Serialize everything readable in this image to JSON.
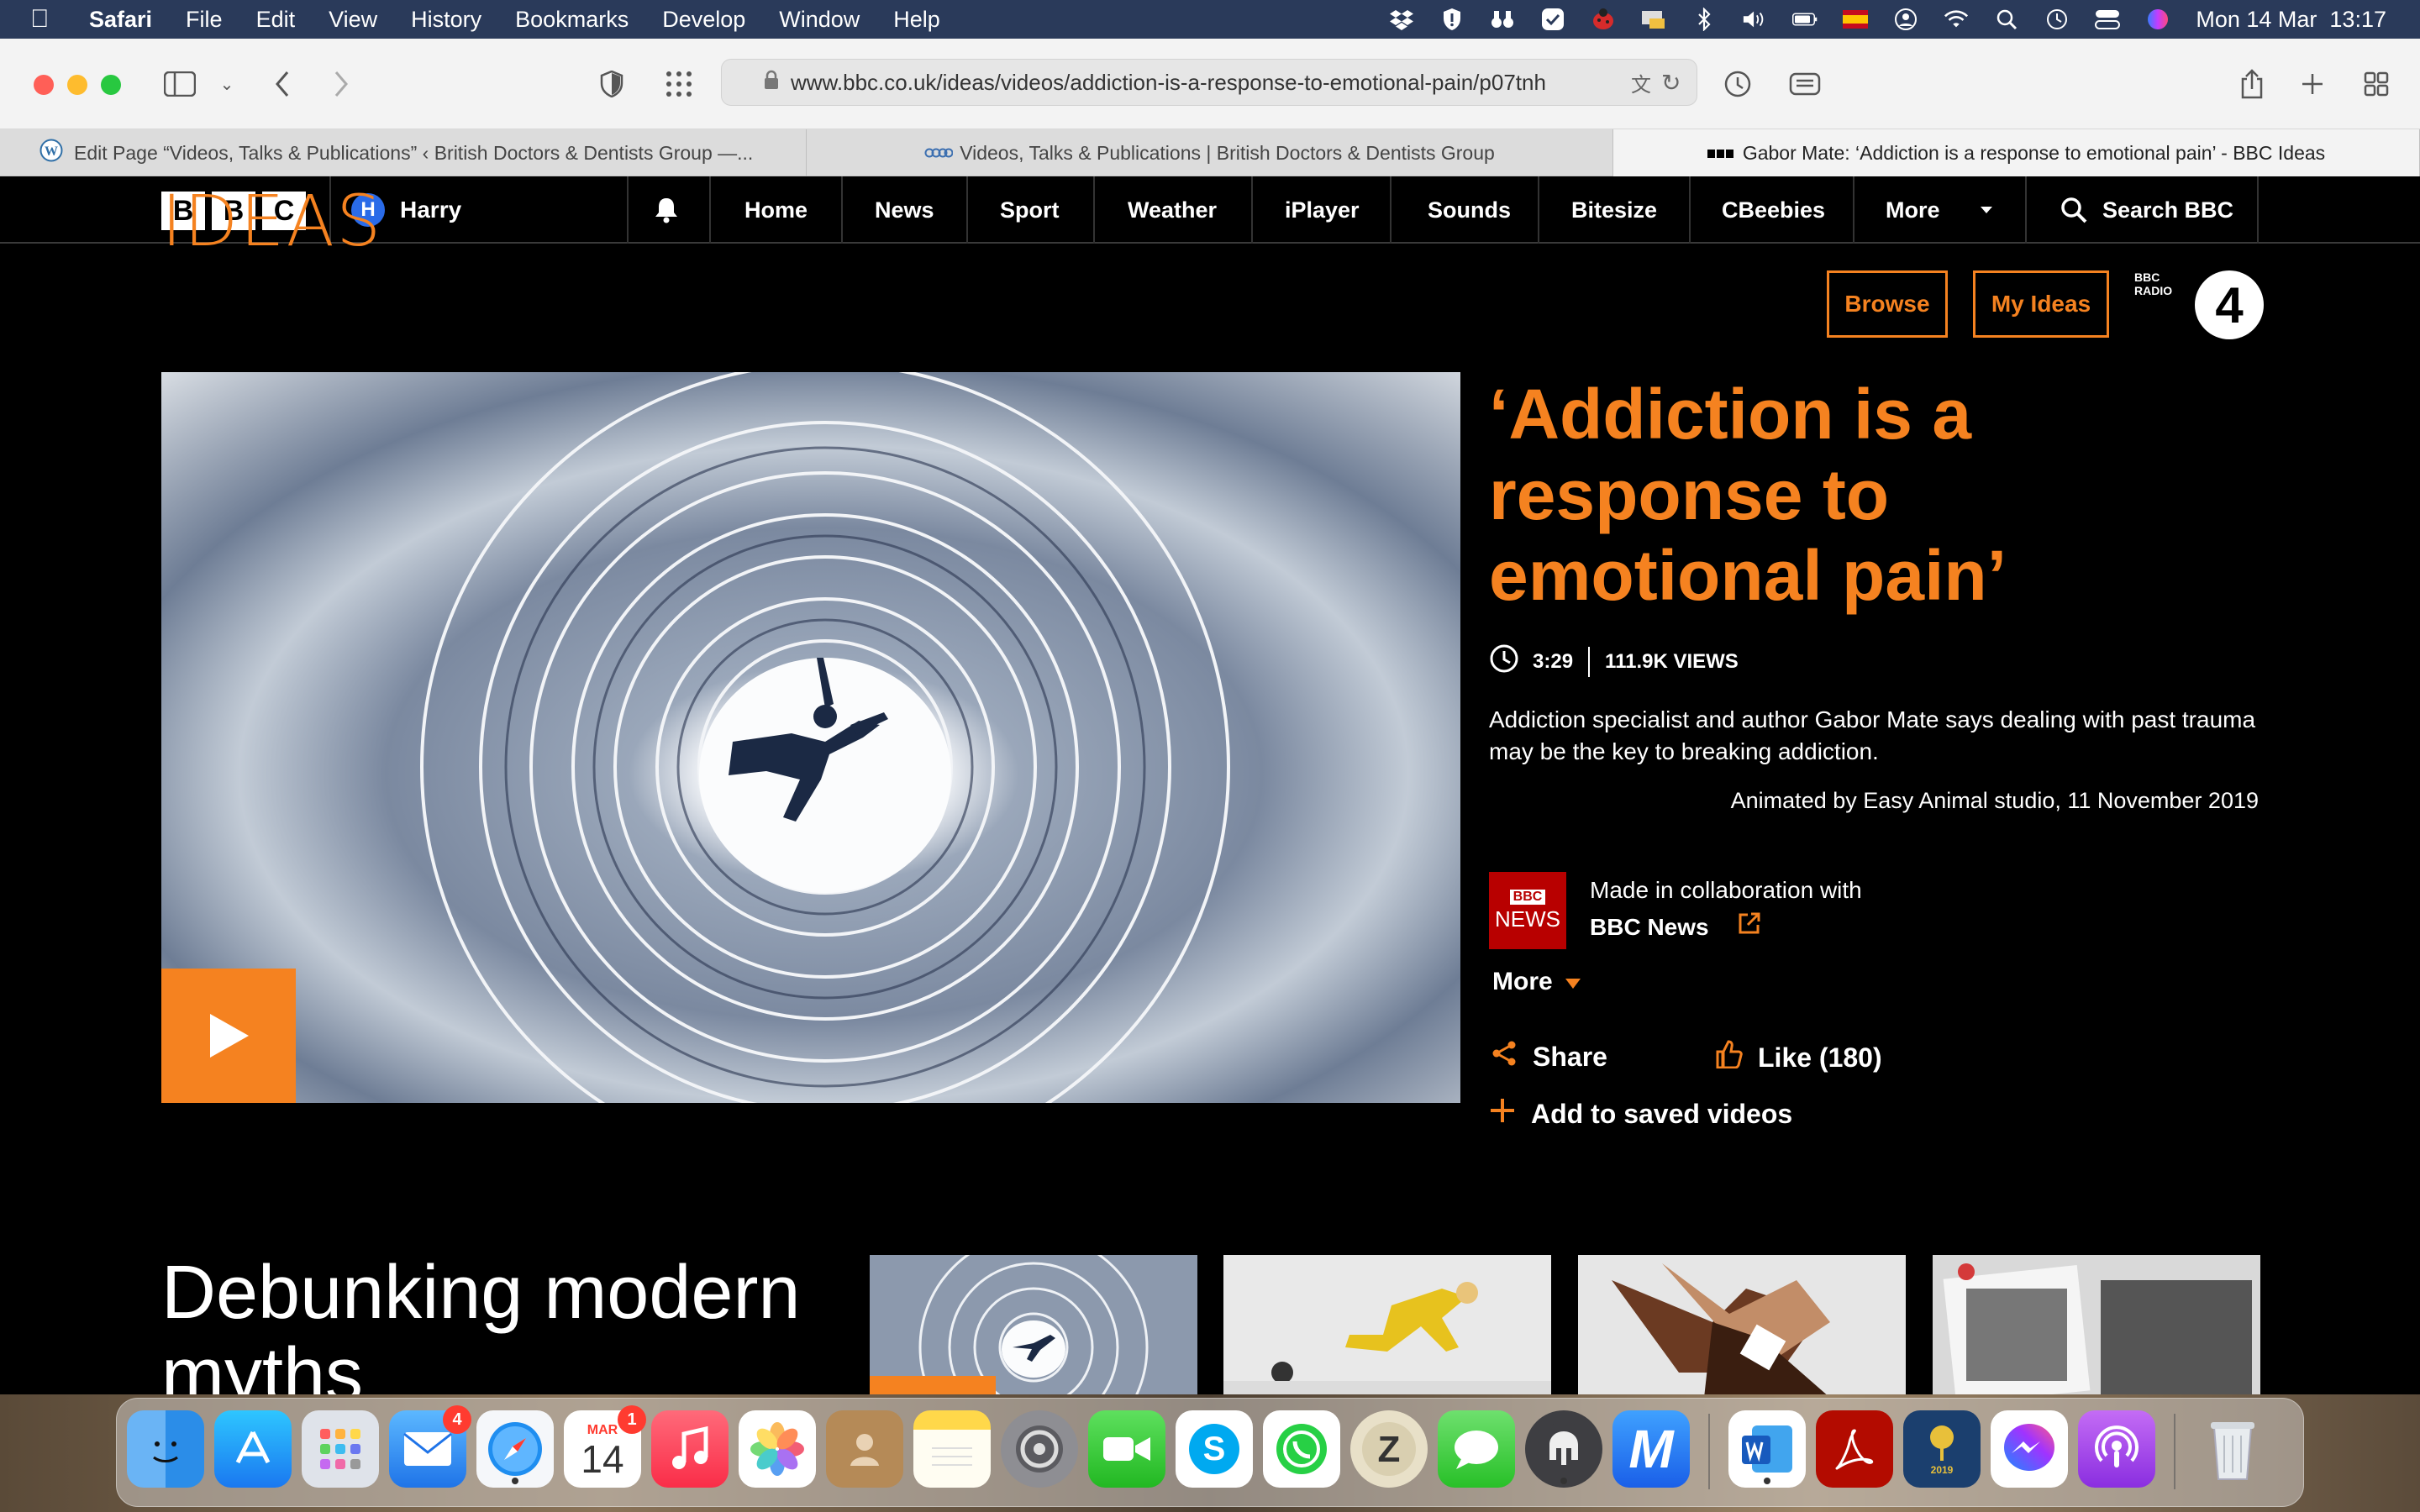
{
  "menubar": {
    "app": "Safari",
    "items": [
      "File",
      "Edit",
      "View",
      "History",
      "Bookmarks",
      "Develop",
      "Window",
      "Help"
    ],
    "clock": "Mon 14 Mar  13:17",
    "status_icons": [
      "dropbox-icon",
      "shield-icon",
      "binoculars-icon",
      "check-icon",
      "ladybug-icon",
      "cast-icon",
      "bluetooth-icon",
      "volume-icon",
      "battery-icon",
      "spain-flag-icon",
      "user-icon",
      "wifi-icon",
      "spotlight-icon",
      "time-machine-icon",
      "control-center-icon",
      "siri-icon"
    ]
  },
  "browser": {
    "url": "www.bbc.co.uk/ideas/videos/addiction-is-a-response-to-emotional-pain/p07tnh",
    "tabs": [
      {
        "title": "Edit Page “Videos, Talks & Publications” ‹ British Doctors & Dentists Group —...",
        "icon": "wordpress-icon"
      },
      {
        "title": "Videos, Talks & Publications | British Doctors & Dentists Group",
        "icon": "site-icon"
      },
      {
        "title": "Gabor Mate: ‘Addiction is a response to emotional pain’ - BBC Ideas",
        "icon": "bbc-icon"
      }
    ]
  },
  "bbc_nav": {
    "logo": [
      "B",
      "B",
      "C"
    ],
    "account": {
      "initial": "H",
      "name": "Harry"
    },
    "links": [
      "Home",
      "News",
      "Sport",
      "Weather",
      "iPlayer",
      "Sounds",
      "Bitesize",
      "CBeebies",
      "More"
    ],
    "search": "Search BBC"
  },
  "ideas": {
    "logo": "IDEAS",
    "browse": "Browse",
    "my_ideas": "My Ideas",
    "radio_small": [
      "BBC",
      "RADIO"
    ],
    "radio_number": "4"
  },
  "video": {
    "title": "‘Addiction is a response to emotional pain’",
    "duration": "3:29",
    "views": "111.9K VIEWS",
    "description": "Addiction specialist and author Gabor Mate says dealing with past trauma may be the key to breaking addiction.",
    "credit": "Animated by Easy Animal studio, 11 November 2019",
    "collab_logo": [
      "BBC",
      "NEWS"
    ],
    "collab_label": "Made in collaboration with",
    "collab_name": "BBC News",
    "more": "More",
    "share": "Share",
    "like": "Like (180)",
    "save": "Add to saved videos"
  },
  "section": {
    "title": "Debunking modern myths"
  },
  "dock": {
    "mail_badge": "4",
    "calendar_month": "MAR",
    "calendar_day": "14",
    "calendar_badge": "1",
    "year_label": "2019",
    "skype_letter": "S",
    "zoom_letter": "Z",
    "m_letter": "M"
  }
}
